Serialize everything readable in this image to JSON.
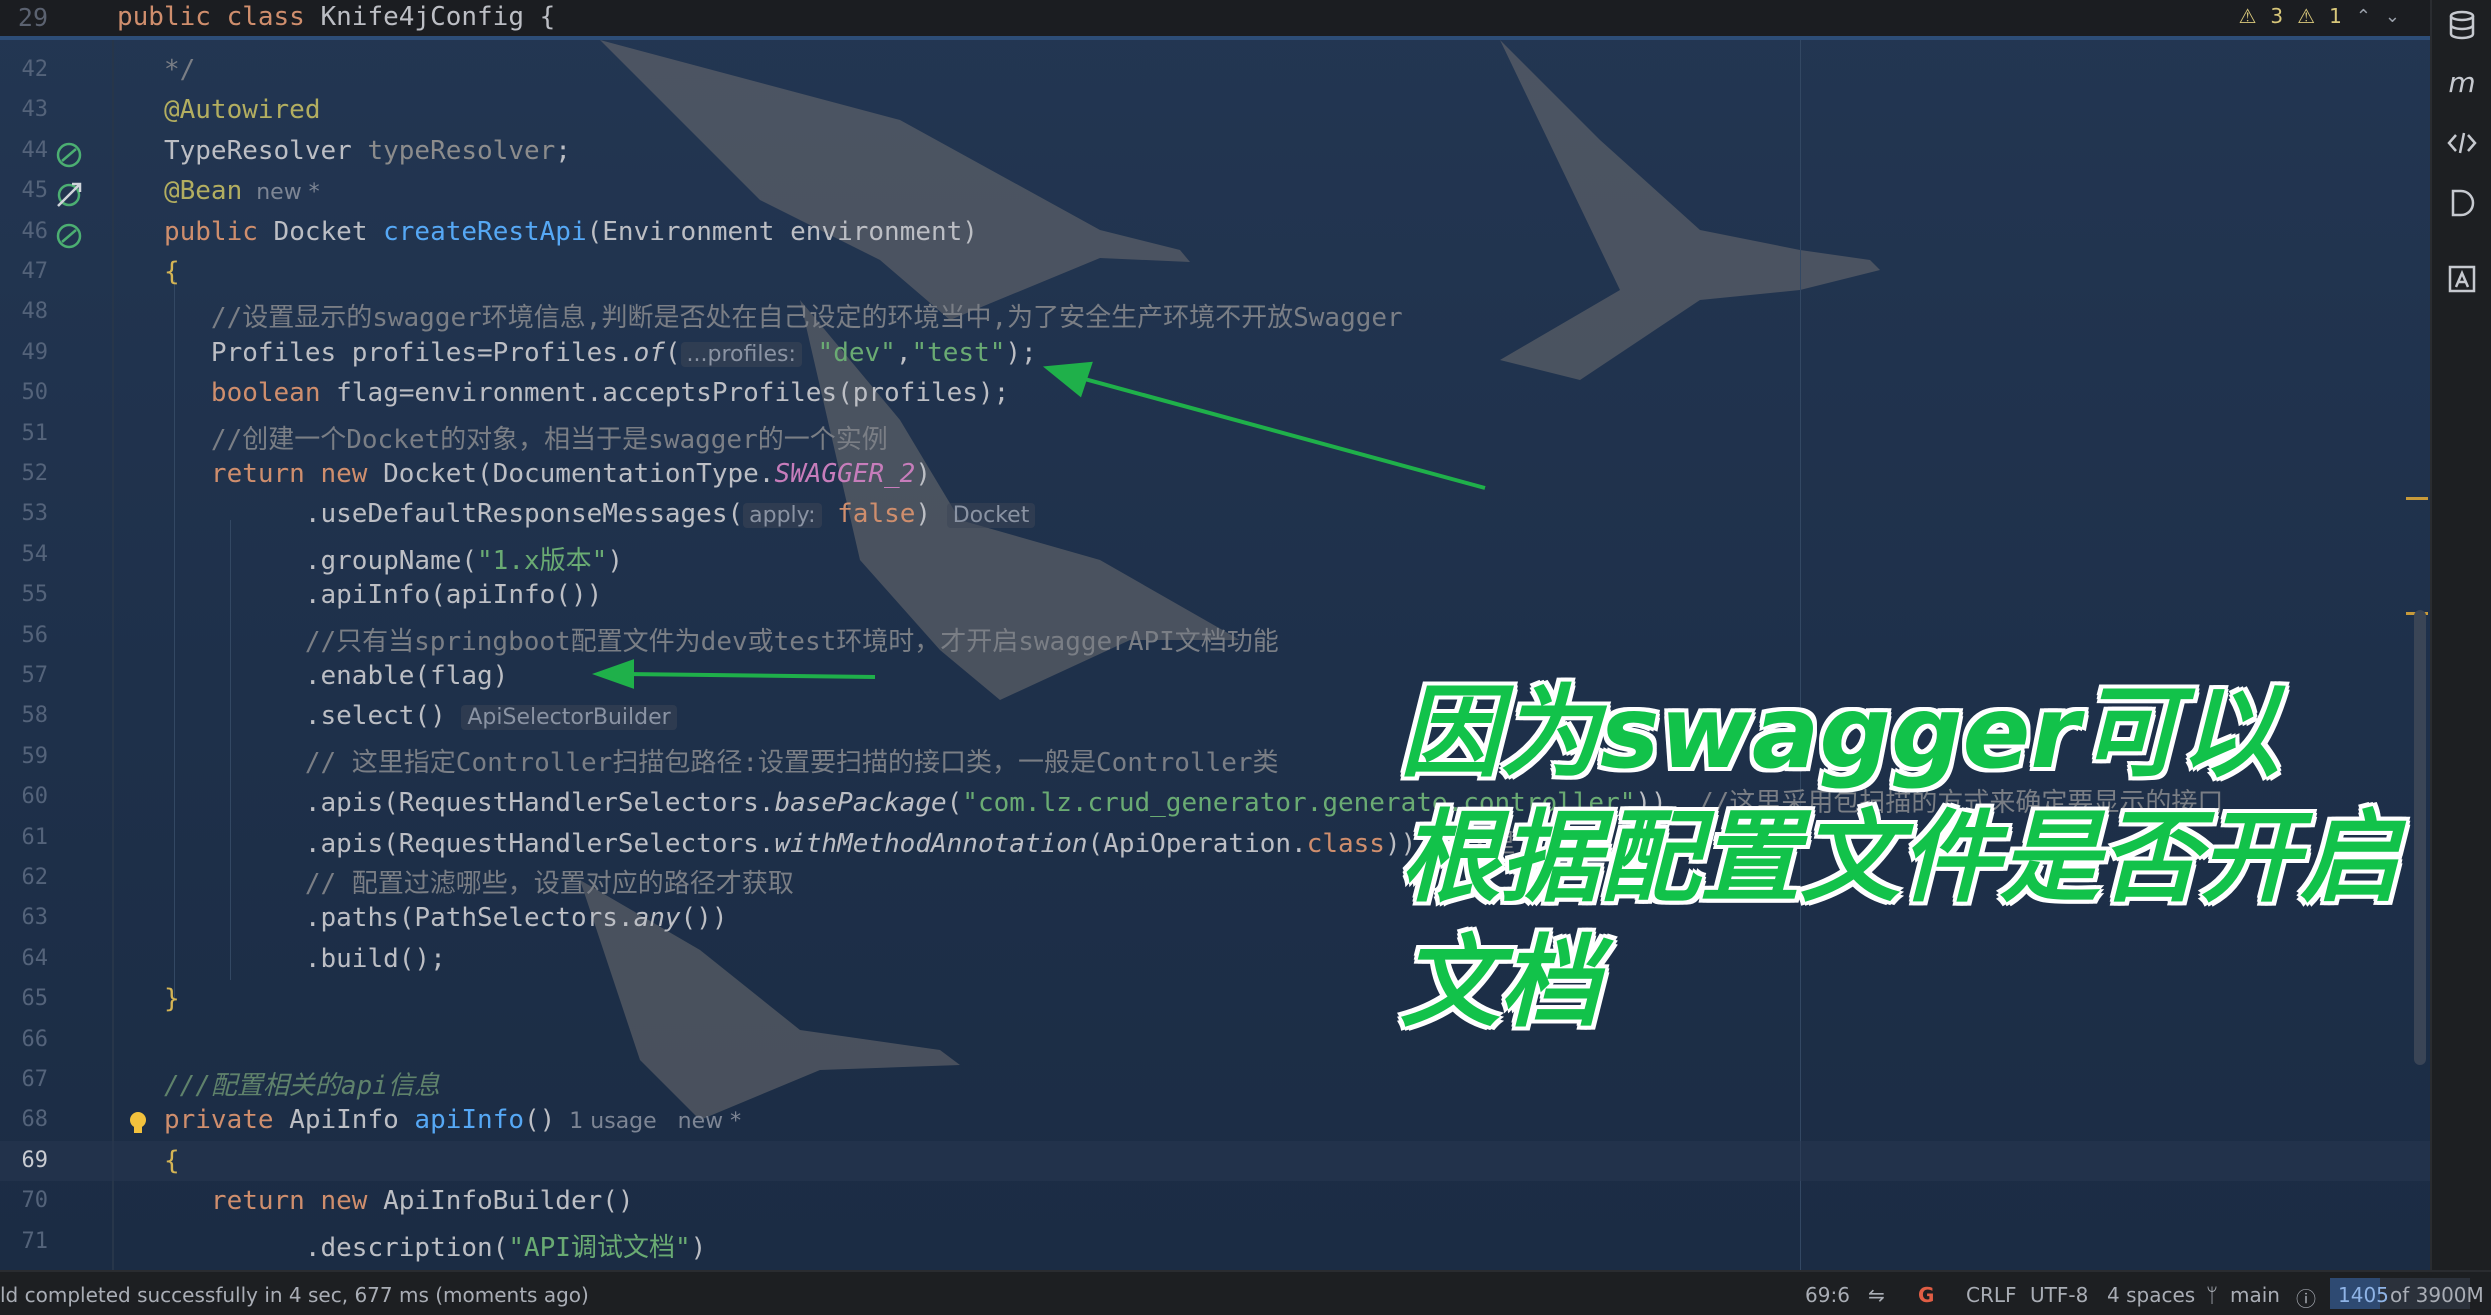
{
  "sticky": {
    "line": "29",
    "code_kw": "public class ",
    "code_name": "Knife4jConfig {"
  },
  "inspections": {
    "warnings": "3",
    "weak_warnings": "1"
  },
  "lines": [
    {
      "n": "42",
      "parts": [
        {
          "t": "   */",
          "c": "cmt"
        }
      ]
    },
    {
      "n": "43",
      "parts": [
        {
          "t": "   @Autowired",
          "c": "ann"
        }
      ]
    },
    {
      "n": "44",
      "parts": [
        {
          "t": "   TypeResolver ",
          "c": ""
        },
        {
          "t": "typeResolver",
          "c": "param"
        },
        {
          "t": ";",
          "c": ""
        }
      ]
    },
    {
      "n": "45",
      "parts": [
        {
          "t": "   @Bean",
          "c": "ann"
        },
        {
          "t": "  new *",
          "c": "hint-plain"
        }
      ]
    },
    {
      "n": "46",
      "parts": [
        {
          "t": "   public ",
          "c": "kw"
        },
        {
          "t": "Docket ",
          "c": ""
        },
        {
          "t": "createRestApi",
          "c": "fn"
        },
        {
          "t": "(Environment environment)",
          "c": ""
        }
      ]
    },
    {
      "n": "47",
      "parts": [
        {
          "t": "   {",
          "c": "paren"
        }
      ]
    },
    {
      "n": "48",
      "parts": [
        {
          "t": "      //设置显示的swagger环境信息,判断是否处在自己设定的环境当中,为了安全生产环境不开放Swagger",
          "c": "cmt"
        }
      ]
    },
    {
      "n": "49",
      "parts": [
        {
          "t": "      Profiles profiles=Profiles.",
          "c": ""
        },
        {
          "t": "of",
          "c": "it"
        },
        {
          "t": "(",
          "c": ""
        },
        {
          "t": "...profiles:",
          "c": "hint"
        },
        {
          "t": " \"dev\"",
          "c": "str"
        },
        {
          "t": ",",
          "c": ""
        },
        {
          "t": "\"test\"",
          "c": "str"
        },
        {
          "t": ");",
          "c": ""
        }
      ]
    },
    {
      "n": "50",
      "parts": [
        {
          "t": "      boolean ",
          "c": "kw"
        },
        {
          "t": "flag=environment.acceptsProfiles(profiles);",
          "c": ""
        }
      ]
    },
    {
      "n": "51",
      "parts": [
        {
          "t": "      //创建一个Docket的对象，相当于是swagger的一个实例",
          "c": "cmt"
        }
      ]
    },
    {
      "n": "52",
      "parts": [
        {
          "t": "      return new ",
          "c": "kw"
        },
        {
          "t": "Docket(DocumentationType.",
          "c": ""
        },
        {
          "t": "SWAGGER_2",
          "c": "const"
        },
        {
          "t": ")",
          "c": ""
        }
      ]
    },
    {
      "n": "53",
      "parts": [
        {
          "t": "            .useDefaultResponseMessages(",
          "c": ""
        },
        {
          "t": "apply:",
          "c": "hint"
        },
        {
          "t": " false",
          "c": "kw"
        },
        {
          "t": ") ",
          "c": ""
        },
        {
          "t": "Docket",
          "c": "hint"
        }
      ]
    },
    {
      "n": "54",
      "parts": [
        {
          "t": "            .groupName(",
          "c": ""
        },
        {
          "t": "\"1.x版本\"",
          "c": "str"
        },
        {
          "t": ")",
          "c": ""
        }
      ]
    },
    {
      "n": "55",
      "parts": [
        {
          "t": "            .apiInfo(apiInfo())",
          "c": ""
        }
      ]
    },
    {
      "n": "56",
      "parts": [
        {
          "t": "            //只有当springboot配置文件为dev或test环境时，才开启swaggerAPI文档功能",
          "c": "cmt"
        }
      ]
    },
    {
      "n": "57",
      "parts": [
        {
          "t": "            .enable(flag)",
          "c": ""
        }
      ]
    },
    {
      "n": "58",
      "parts": [
        {
          "t": "            .select() ",
          "c": ""
        },
        {
          "t": "ApiSelectorBuilder",
          "c": "hint"
        }
      ]
    },
    {
      "n": "59",
      "parts": [
        {
          "t": "            // 这里指定Controller扫描包路径:设置要扫描的接口类，一般是Controller类",
          "c": "cmt"
        }
      ]
    },
    {
      "n": "60",
      "parts": [
        {
          "t": "            .apis(RequestHandlerSelectors.",
          "c": ""
        },
        {
          "t": "basePackage",
          "c": "it"
        },
        {
          "t": "(",
          "c": ""
        },
        {
          "t": "\"com.lz.crud_generator.generate.controller\"",
          "c": "str"
        },
        {
          "t": "))  ",
          "c": ""
        },
        {
          "t": "//这里采用包扫描的方式来确定要显示的接口",
          "c": "cmt"
        }
      ]
    },
    {
      "n": "61",
      "parts": [
        {
          "t": "            .apis(RequestHandlerSelectors.",
          "c": ""
        },
        {
          "t": "withMethodAnnotation",
          "c": "it"
        },
        {
          "t": "(ApiOperation.",
          "c": ""
        },
        {
          "t": "class",
          "c": "kw"
        },
        {
          "t": ")) ",
          "c": ""
        },
        {
          "t": "//这里",
          "c": "cmt"
        }
      ]
    },
    {
      "n": "62",
      "parts": [
        {
          "t": "            // 配置过滤哪些，设置对应的路径才获取",
          "c": "cmt"
        }
      ]
    },
    {
      "n": "63",
      "parts": [
        {
          "t": "            .paths(PathSelectors.",
          "c": ""
        },
        {
          "t": "any",
          "c": "it"
        },
        {
          "t": "())",
          "c": ""
        }
      ]
    },
    {
      "n": "64",
      "parts": [
        {
          "t": "            .build();",
          "c": ""
        }
      ]
    },
    {
      "n": "65",
      "parts": [
        {
          "t": "   }",
          "c": "paren"
        }
      ]
    },
    {
      "n": "66",
      "parts": [
        {
          "t": "",
          "c": ""
        }
      ]
    },
    {
      "n": "67",
      "parts": [
        {
          "t": "   ///配置相关的api信息",
          "c": "doc"
        }
      ]
    },
    {
      "n": "68",
      "parts": [
        {
          "t": "   private ",
          "c": "kw"
        },
        {
          "t": "ApiInfo ",
          "c": ""
        },
        {
          "t": "apiInfo",
          "c": "fn"
        },
        {
          "t": "()",
          "c": ""
        },
        {
          "t": "  1 usage   new *",
          "c": "hint-plain"
        }
      ]
    },
    {
      "n": "69",
      "parts": [
        {
          "t": "   {",
          "c": "paren"
        }
      ]
    },
    {
      "n": "70",
      "parts": [
        {
          "t": "      return new ",
          "c": "kw"
        },
        {
          "t": "ApiInfoBuilder()",
          "c": ""
        }
      ]
    },
    {
      "n": "71",
      "parts": [
        {
          "t": "            .description(",
          "c": ""
        },
        {
          "t": "\"API调试文档\"",
          "c": "str"
        },
        {
          "t": ")",
          "c": ""
        }
      ]
    }
  ],
  "current_line": "69",
  "caption": {
    "line1": "因为swagger可以",
    "line2": "根据配置文件是否开启",
    "line3": "文档"
  },
  "status": {
    "build_message": "ld completed successfully in 4 sec, 677 ms (moments ago)",
    "position": "69:6",
    "line_separator": "CRLF",
    "encoding": "UTF-8",
    "indent": "4 spaces",
    "branch": "main",
    "memory_used": "1405",
    "memory_total": "of 3900M",
    "memory_fraction": 0.36
  },
  "colors": {
    "background": "#1f3149",
    "caption_green": "#12c24a",
    "arrow_green": "#1fb04a",
    "keyword": "#cf8e6d",
    "string": "#6aab73",
    "function": "#56a8f5",
    "annotation": "#b3ae60"
  },
  "icons": {
    "gutter_44": "bean-implemented-icon",
    "gutter_45": "bean-navigate-icon",
    "gutter_46": "bean-method-icon",
    "gutter_68": "lightbulb-icon",
    "toolbar": [
      "database-icon",
      "maven-icon",
      "endpoints-icon",
      "d-plugin-icon",
      "font-icon"
    ]
  }
}
